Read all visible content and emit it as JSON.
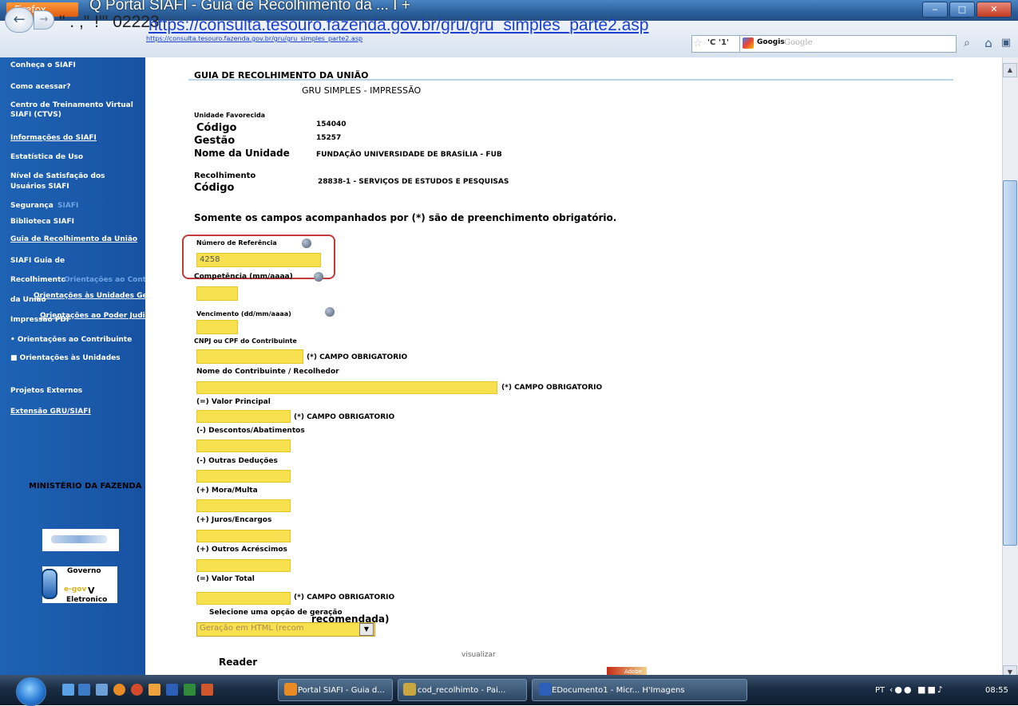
{
  "browser": {
    "app_button": "Firefox",
    "tab_title": "Q Portal SIAFI - Guia de Recolhimento da ... I +",
    "url_prefix": "\" . ,\" !\"' 02223",
    "url_big": "https://consulta.tesouro.fazenda.gov.br/gru/gru_simples_parte2.asp",
    "url_small": "https://consulta.tesouro.fazenda.gov.br/gru/gru_simples_parte2.asp",
    "reload_label": "'C '1'",
    "search_engine": "Googis",
    "search_placeholder": "Google"
  },
  "sidebar": {
    "items": [
      "Conheça o SIAFI",
      "Como acessar?",
      "Centro de Treinamento Virtual",
      "SIAFI (CTVS)",
      "Informações do SIAFI",
      "Estatística de Uso",
      "Nível de Satisfação dos",
      "Usuários SIAFI",
      "Segurança",
      "SIAFI",
      "Biblioteca SIAFI",
      "Guia de Recolhimento da União",
      "SIAFI Guia de",
      "Recolhimento",
      "da União",
      "Orientações ao Contribuinte",
      "Orientações às Unidades Gestoras",
      "Impressão PDF",
      "Orientações ao Poder Judiciário",
      "• Orientações ao Contribuinte",
      "■ Orientações às Unidades",
      "Projetos Externos",
      "Extensão GRU/SIAFI"
    ],
    "ministerio": "MINISTÉRIO DA FAZENDA",
    "gov_line1": "Governo",
    "gov_line2": "e-gov",
    "gov_line3": "V",
    "gov_line4": "Eletronico"
  },
  "form": {
    "title": "GUIA DE RECOLHIMENTO DA UNIÃO",
    "subtitle": "GRU SIMPLES - IMPRESSÃO",
    "unidade_favorecida": "Unidade Favorecida",
    "codigo_label": "Código",
    "gestao_label": "Gestão",
    "codigo_value": "154040",
    "gestao_value": "15257",
    "nome_unidade_label": "Nome da Unidade",
    "nome_unidade_value": "FUNDAÇÃO UNIVERSIDADE DE BRASÍLIA - FUB",
    "recolhimento_label": "Recolhimento",
    "codigo2_label": "Código",
    "recolhimento_value": "28838-1 - SERVIÇOS DE ESTUDOS E PESQUISAS",
    "required_note": "Somente os campos acompanhados por (*) são de preenchimento obrigatório.",
    "numero_referencia_label": "Número de Referência",
    "numero_referencia_value": "4258",
    "competencia_label": "Competência (mm/aaaa)",
    "vencimento_label": "Vencimento (dd/mm/aaaa)",
    "cnpj_label": "CNPJ ou CPF do Contribuinte",
    "campo_obrigatorio": "(*) CAMPO OBRIGATORIO",
    "nome_contribuinte_label": "Nome do Contribuinte / Recolhedor",
    "valor_principal_label": "(=) Valor Principal",
    "descontos_label": "(-) Descontos/Abatimentos",
    "outras_deducoes_label": "(-) Outras Deduções",
    "mora_label": "(+) Mora/Multa",
    "juros_label": "(+) Juros/Encargos",
    "outros_acrescimos_label": "(+) Outros Acréscimos",
    "valor_total_label": "(=) Valor Total",
    "selecione_label": "Selecione uma opção de geração",
    "recomendada_label": "recomendada)",
    "select_value": "Geração em HTML (recom",
    "visualizar_label": "visualizar",
    "reader_label": "Reader",
    "adobe_label": "Adobe"
  },
  "taskbar": {
    "items": [
      "Portal SIAFI - Guia d...",
      "cod_recolhimto - Pai...",
      "EDocumento1 - Micr... H'Imagens"
    ],
    "lang": "PT",
    "clock": "08:55"
  },
  "colors": {
    "sidebar_blue": "#1e62b4",
    "field_yellow": "#f7e14e",
    "highlight_red": "#c43a3a",
    "link_blue": "#1a3fd1"
  }
}
